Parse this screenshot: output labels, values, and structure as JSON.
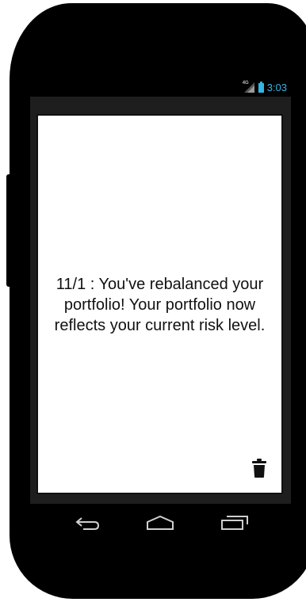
{
  "status_bar": {
    "network_label": "4G",
    "network_icon": "signal-icon",
    "battery_icon": "battery-icon",
    "time": "3:03",
    "time_color": "#33b5e5"
  },
  "notification": {
    "message": "11/1 : You've rebalanced your portfolio! Your portfolio now reflects your current risk level.",
    "delete_icon": "trash-icon"
  },
  "nav_bar": {
    "back_icon": "back-icon",
    "home_icon": "home-icon",
    "recents_icon": "recents-icon"
  }
}
